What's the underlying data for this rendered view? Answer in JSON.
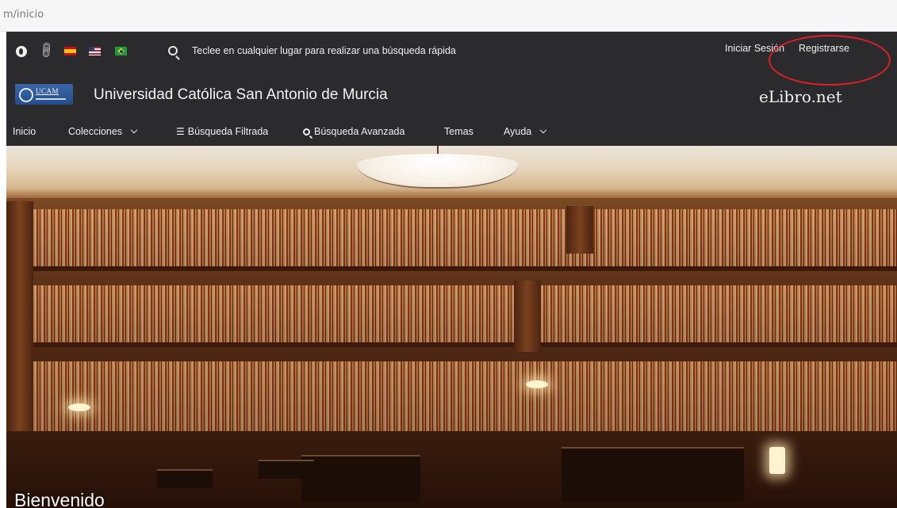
{
  "browser": {
    "url_fragment": "m/inicio"
  },
  "topbar": {
    "search_hint": "Teclee en cualquier lugar para realizar una búsqueda rápida",
    "login_label": "Iniciar Sesión",
    "register_label": "Registrarse",
    "icons": [
      "globe-icon",
      "link-icon",
      "flag-spain-icon",
      "flag-usa-icon",
      "flag-brazil-icon",
      "search-icon"
    ]
  },
  "brand": {
    "logo_text": "UCAM",
    "university_name": "Universidad Católica San Antonio de Murcia",
    "site_logo": "eLibro.net"
  },
  "nav": {
    "items": [
      {
        "label": "Inicio"
      },
      {
        "label": "Colecciones"
      },
      {
        "label": "Búsqueda Filtrada"
      },
      {
        "label": "Búsqueda Avanzada"
      },
      {
        "label": "Temas"
      },
      {
        "label": "Ayuda"
      }
    ]
  },
  "hero": {
    "title": "Bienvenido"
  },
  "colors": {
    "header_bg": "#2b2b2e",
    "text": "#f0f0f0",
    "annotation_red": "#e01f25",
    "ucam_blue": "#2f5b9c"
  }
}
